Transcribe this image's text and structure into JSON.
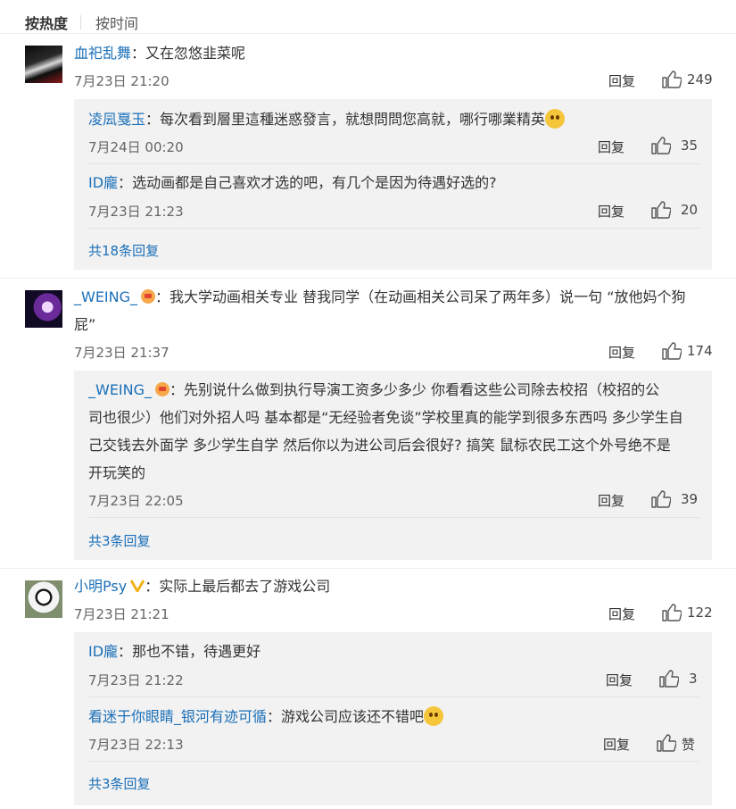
{
  "sort": {
    "hot": "按热度",
    "time": "按时间"
  },
  "comments": [
    {
      "user": "血祀乱舞",
      "sep": "：",
      "text": "又在忽悠韭菜呢",
      "time": "7月23日 21:20",
      "reply": "回复",
      "likes": "249",
      "replies": [
        {
          "user": "凌凨戛玉",
          "sep": "：",
          "text": "每次看到層里這種迷惑發言，就想問問您高就，哪行哪業精英",
          "emoji": "thinking-emoji",
          "time": "7月24日 00:20",
          "reply": "回复",
          "likes": "35"
        },
        {
          "user": "ID龐",
          "sep": "：",
          "text": "选动画都是自己喜欢才选的吧，有几个是因为待遇好选的?",
          "time": "7月23日 21:23",
          "reply": "回复",
          "likes": "20"
        }
      ],
      "more": "共18条回复"
    },
    {
      "user": "_WEING_",
      "badge": "crown-badge-icon",
      "sep": "：",
      "text_line1": "我大学动画相关专业 替我同学（在动画相关公司呆了两年多）说一句 “放他妈个狗",
      "text_line2": "屁”",
      "time": "7月23日 21:37",
      "reply": "回复",
      "likes": "174",
      "replies": [
        {
          "user": "_WEING_",
          "sep": "：",
          "lines": [
            "先别说什么做到执行导演工资多少多少 你看看这些公司除去校招（校招的公",
            "司也很少）他们对外招人吗 基本都是“无经验者免谈”学校里真的能学到很多东西吗 多少学生自",
            "己交钱去外面学 多少学生自学 然后你以为进公司后会很好? 搞笑 鼠标农民工这个外号绝不是",
            "开玩笑的"
          ],
          "time": "7月23日 22:05",
          "reply": "回复",
          "likes": "39"
        }
      ],
      "more": "共3条回复"
    },
    {
      "user": "小明Psy",
      "badge": "v-badge-icon",
      "sep": "：",
      "text": "实际上最后都去了游戏公司",
      "time": "7月23日 21:21",
      "reply": "回复",
      "likes": "122",
      "replies": [
        {
          "user": "ID龐",
          "sep": "：",
          "text": "那也不错，待遇更好",
          "time": "7月23日 21:22",
          "reply": "回复",
          "likes": "3"
        },
        {
          "user": "看迷于你眼睛_银河有迹可循",
          "sep": "：",
          "text": "游戏公司应该还不错吧",
          "emoji": "smile-emoji",
          "time": "7月23日 22:13",
          "reply": "回复",
          "likes": "赞"
        }
      ],
      "more": "共3条回复"
    }
  ],
  "colors": {
    "link": "#1a6fb8",
    "reply_bg": "#f2f2f2",
    "emoji": "#f5c53a"
  }
}
